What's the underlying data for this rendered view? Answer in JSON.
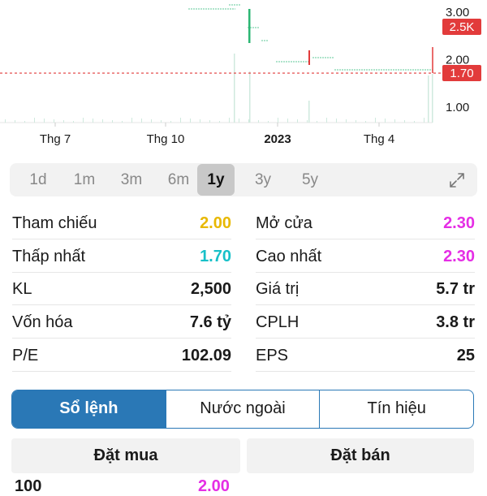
{
  "chart": {
    "price_axis": [
      "3.00",
      "2.00",
      "1.00"
    ],
    "last_volume_badge": "2.5K",
    "current_price_badge": "1.70",
    "current_price": 1.7,
    "time_axis": [
      "Thg 7",
      "Thg 10",
      "2023",
      "Thg 4"
    ],
    "colors": {
      "up": "#2bb673",
      "down": "#e23b3b",
      "reference_line": "#e23b3b",
      "volume_bars": "#cfe9de"
    }
  },
  "ranges": {
    "items": [
      "1d",
      "1m",
      "3m",
      "6m",
      "1y",
      "3y",
      "5y"
    ],
    "selected": "1y",
    "expand_icon": "expand-icon"
  },
  "stats": {
    "left": [
      {
        "label": "Tham chiếu",
        "value": "2.00",
        "color": "#e8b800"
      },
      {
        "label": "Thấp nhất",
        "value": "1.70",
        "color": "#17c0c8"
      },
      {
        "label": "KL",
        "value": "2,500",
        "color": "#1a1a1a"
      },
      {
        "label": "Vốn hóa",
        "value": "7.6 tỷ",
        "color": "#1a1a1a"
      },
      {
        "label": "P/E",
        "value": "102.09",
        "color": "#1a1a1a"
      }
    ],
    "right": [
      {
        "label": "Mở cửa",
        "value": "2.30",
        "color": "#e52ee5"
      },
      {
        "label": "Cao nhất",
        "value": "2.30",
        "color": "#e52ee5"
      },
      {
        "label": "Giá trị",
        "value": "5.7 tr",
        "color": "#1a1a1a"
      },
      {
        "label": "CPLH",
        "value": "3.8 tr",
        "color": "#1a1a1a"
      },
      {
        "label": "EPS",
        "value": "25",
        "color": "#1a1a1a"
      }
    ]
  },
  "tabs": {
    "items": [
      "Sổ lệnh",
      "Nước ngoài",
      "Tín hiệu"
    ],
    "selected": "Sổ lệnh"
  },
  "orderbook": {
    "buy_header": "Đặt mua",
    "sell_header": "Đặt bán",
    "first_row": {
      "volume": "100",
      "price": "2.00"
    }
  }
}
